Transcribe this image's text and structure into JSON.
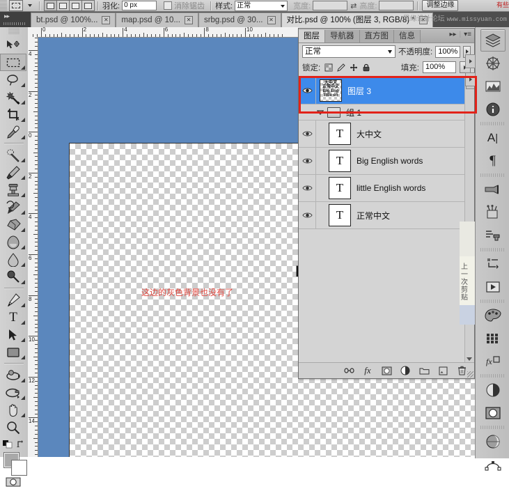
{
  "app": {
    "name": "Adobe Photoshop"
  },
  "options_bar": {
    "tool_icon": "rectangular-marquee-icon",
    "boolean_modes": [
      "new-selection",
      "add-to-selection",
      "subtract-from-selection",
      "intersect-selection"
    ],
    "feather_label": "羽化:",
    "feather_value": "0 px",
    "antialias_label": "消除锯齿",
    "antialias_checked": false,
    "style_label": "样式:",
    "style_value": "正常",
    "width_label": "宽度:",
    "width_value": "",
    "height_label": "高度:",
    "height_value": "",
    "refine_edge_label": "调整边缘"
  },
  "watermark": {
    "forum": "思缘设计论坛",
    "url": "www.missyuan.com",
    "corner": "有些"
  },
  "tabs": [
    {
      "title": "bt.psd @ 100%...",
      "active": false,
      "close": "✕"
    },
    {
      "title": "map.psd @ 10...",
      "active": false,
      "close": "✕"
    },
    {
      "title": "srbg.psd @ 30...",
      "active": false,
      "close": "✕"
    },
    {
      "title": "对比.psd @ 100% (图层 3, RGB/8) *",
      "active": true,
      "close": "✕"
    }
  ],
  "toolbar": {
    "tools": [
      {
        "name": "move-tool",
        "selected": false,
        "has_flyout": false
      },
      {
        "name": "rectangular-marquee-tool",
        "selected": true,
        "has_flyout": true
      },
      {
        "name": "lasso-tool",
        "selected": false,
        "has_flyout": true
      },
      {
        "name": "magic-wand-tool",
        "selected": false,
        "has_flyout": true
      },
      {
        "name": "crop-tool",
        "selected": false,
        "has_flyout": true
      },
      {
        "name": "eyedropper-tool",
        "selected": false,
        "has_flyout": true
      },
      {
        "name": "healing-brush-tool",
        "selected": false,
        "has_flyout": true
      },
      {
        "name": "brush-tool",
        "selected": false,
        "has_flyout": true
      },
      {
        "name": "clone-stamp-tool",
        "selected": false,
        "has_flyout": true
      },
      {
        "name": "history-brush-tool",
        "selected": false,
        "has_flyout": true
      },
      {
        "name": "eraser-tool",
        "selected": false,
        "has_flyout": true
      },
      {
        "name": "gradient-tool",
        "selected": false,
        "has_flyout": true
      },
      {
        "name": "blur-tool",
        "selected": false,
        "has_flyout": true
      },
      {
        "name": "dodge-tool",
        "selected": false,
        "has_flyout": true
      },
      {
        "name": "pen-tool",
        "selected": false,
        "has_flyout": true
      },
      {
        "name": "type-tool",
        "selected": false,
        "has_flyout": true
      },
      {
        "name": "path-selection-tool",
        "selected": false,
        "has_flyout": true
      },
      {
        "name": "rectangle-shape-tool",
        "selected": false,
        "has_flyout": true
      },
      {
        "name": "3d-rotate-tool",
        "selected": false,
        "has_flyout": true
      },
      {
        "name": "3d-orbit-tool",
        "selected": false,
        "has_flyout": true
      },
      {
        "name": "hand-tool",
        "selected": false,
        "has_flyout": true
      },
      {
        "name": "zoom-tool",
        "selected": false,
        "has_flyout": false
      }
    ],
    "foreground_color": "#a9a9a9",
    "background_color": "#ffffff",
    "quickmask_name": "quick-mask-icon"
  },
  "rulers": {
    "unit": "cm",
    "horizontal_labels": [
      "0",
      "2",
      "4",
      "6",
      "8",
      "10"
    ],
    "vertical_labels": [
      "4",
      "2",
      "0",
      "2",
      "4",
      "6",
      "8",
      "10",
      "12",
      "14"
    ]
  },
  "canvas": {
    "background_color": "#5b87bd",
    "transparency_checker": true,
    "artwork": {
      "big_char": "大",
      "chinese_normal": "正常中文",
      "english_big": "Big En",
      "english_small": "little Eng"
    },
    "annotation": "这边的灰色背景也没有了",
    "annotation_color": "#e0483f"
  },
  "layers_panel": {
    "tabs": [
      {
        "label": "图层",
        "active": true
      },
      {
        "label": "导航器",
        "active": false
      },
      {
        "label": "直方图",
        "active": false
      },
      {
        "label": "信息",
        "active": false
      }
    ],
    "blend_mode": "正常",
    "opacity_label": "不透明度:",
    "opacity_value": "100%",
    "lock_label": "锁定:",
    "lock_icons": [
      "lock-transparent-pixels-icon",
      "lock-image-pixels-icon",
      "lock-position-icon",
      "lock-all-icon"
    ],
    "fill_label": "填充:",
    "fill_value": "100%",
    "layers": [
      {
        "name": "图层 3",
        "type": "pixel",
        "visible": true,
        "selected": true,
        "indent": 0
      },
      {
        "name": "组 1",
        "type": "group",
        "visible": false,
        "selected": false,
        "expanded": true,
        "indent": 0
      },
      {
        "name": "大中文",
        "type": "text",
        "thumb": "T",
        "visible": true,
        "selected": false,
        "indent": 1
      },
      {
        "name": "Big English words",
        "type": "text",
        "thumb": "T",
        "visible": true,
        "selected": false,
        "indent": 1
      },
      {
        "name": "little English words",
        "type": "text",
        "thumb": "T",
        "visible": true,
        "selected": false,
        "indent": 1
      },
      {
        "name": "正常中文",
        "type": "text",
        "thumb": "T",
        "visible": true,
        "selected": false,
        "indent": 1
      }
    ],
    "highlight_color": "#3d8aea",
    "annotation_box_color": "#e2231a",
    "footer_buttons": [
      "link-layers-icon",
      "layer-style-fx-icon",
      "add-layer-mask-icon",
      "new-adjustment-layer-icon",
      "new-group-icon",
      "new-layer-icon",
      "delete-layer-icon"
    ]
  },
  "right_dock": {
    "icons": [
      {
        "name": "layers-icon",
        "active": true
      },
      {
        "name": "navigator-icon",
        "active": false
      },
      {
        "name": "histogram-icon",
        "active": false
      },
      {
        "name": "info-icon",
        "active": false
      },
      {
        "name": "character-icon",
        "active": false
      },
      {
        "name": "paragraph-icon",
        "active": false
      },
      {
        "name": "brushes-icon",
        "active": false
      },
      {
        "name": "tool-presets-icon",
        "active": false
      },
      {
        "name": "clone-source-icon",
        "active": false
      },
      {
        "name": "history-icon",
        "active": false
      },
      {
        "name": "actions-icon",
        "active": false
      },
      {
        "name": "color-icon",
        "active": false
      },
      {
        "name": "swatches-icon",
        "active": false
      },
      {
        "name": "styles-icon",
        "active": false
      },
      {
        "name": "adjustments-icon",
        "active": false
      },
      {
        "name": "masks-icon",
        "active": false
      },
      {
        "name": "3d-icon",
        "active": false
      },
      {
        "name": "paths-icon",
        "active": false
      },
      {
        "name": "measurement-icon",
        "active": false
      }
    ],
    "side_text": "上一次剪贴"
  }
}
